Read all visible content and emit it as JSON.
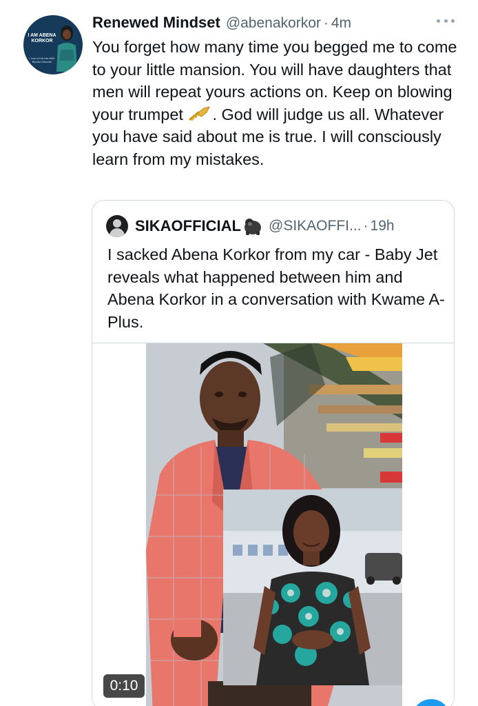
{
  "tweet": {
    "display_name": "Renewed Mindset",
    "handle": "@abenakorkor",
    "separator": "·",
    "time": "4m",
    "text_part1": "You forget how many time you begged me to come to your little mansion. You will have daughters that men will repeat yours actions on. Keep on blowing your trumpet",
    "text_part2": ". God will judge us all. Whatever you have said about me is true. I will consciously learn from my mistakes.",
    "avatar_text": {
      "title": "I AM ABENA KORKOR",
      "subtitle": "I Live A Full Life With Bipolar Disorder"
    }
  },
  "quoted_tweet": {
    "display_name": "SIKAOFFICIAL",
    "handle": "@SIKAOFFI...",
    "separator": "·",
    "time": "19h",
    "text": "I sacked Abena Korkor from my car - Baby Jet reveals what happened between him and Abena Korkor in a conversation with Kwame A-Plus.",
    "media": {
      "video_duration": "0:10"
    }
  },
  "icons": {
    "more": "more-horizontal-icon",
    "trumpet": "trumpet-emoji",
    "gorilla": "gorilla-emoji"
  },
  "colors": {
    "text_primary": "#0f1419",
    "text_secondary": "#536471",
    "border": "#cfd9de",
    "accent": "#1d9bf0"
  }
}
